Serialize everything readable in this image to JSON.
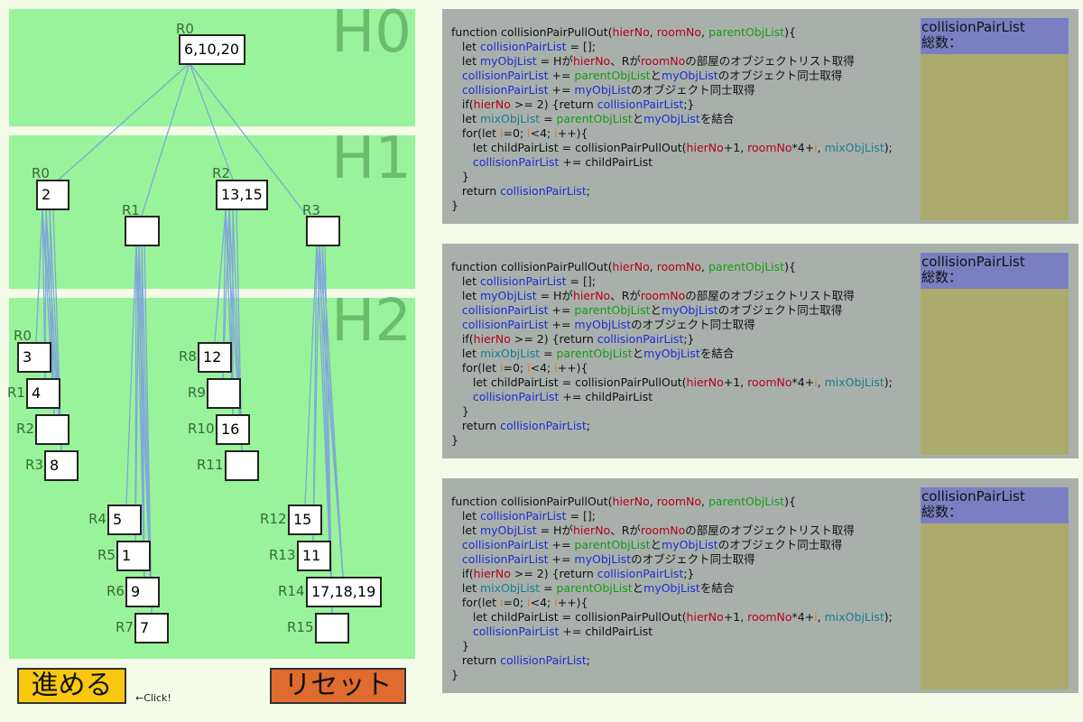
{
  "levels": [
    {
      "label": "H0"
    },
    {
      "label": "H1"
    },
    {
      "label": "H2"
    }
  ],
  "tree": {
    "h0": [
      {
        "room": "R0",
        "objects": "6,10,20"
      }
    ],
    "h1": [
      {
        "room": "R0",
        "objects": "2"
      },
      {
        "room": "R1",
        "objects": ""
      },
      {
        "room": "R2",
        "objects": "13,15"
      },
      {
        "room": "R3",
        "objects": ""
      }
    ],
    "h2": [
      {
        "room": "R0",
        "objects": "3"
      },
      {
        "room": "R1",
        "objects": "4"
      },
      {
        "room": "R2",
        "objects": ""
      },
      {
        "room": "R3",
        "objects": "8"
      },
      {
        "room": "R4",
        "objects": "5"
      },
      {
        "room": "R5",
        "objects": "1"
      },
      {
        "room": "R6",
        "objects": "9"
      },
      {
        "room": "R7",
        "objects": "7"
      },
      {
        "room": "R8",
        "objects": "12"
      },
      {
        "room": "R9",
        "objects": ""
      },
      {
        "room": "R10",
        "objects": "16"
      },
      {
        "room": "R11",
        "objects": ""
      },
      {
        "room": "R12",
        "objects": "15"
      },
      {
        "room": "R13",
        "objects": "11"
      },
      {
        "room": "R14",
        "objects": "17,18,19"
      },
      {
        "room": "R15",
        "objects": ""
      }
    ]
  },
  "code_panels": [
    {
      "result_title": "collisionPairList",
      "result_count_label": "総数："
    },
    {
      "result_title": "collisionPairList",
      "result_count_label": "総数："
    },
    {
      "result_title": "collisionPairList",
      "result_count_label": "総数："
    }
  ],
  "buttons": {
    "advance_label": "進める",
    "reset_label": "リセット",
    "hint": "←Click!"
  },
  "colors": {
    "level_bg": "#98f39a",
    "line": "#7fa8d8",
    "advance": "#f9c80e",
    "reset": "#e06b2e",
    "panel": "#a9b0ac",
    "result_head": "#7b7fc2",
    "result_body": "#abab6d"
  }
}
